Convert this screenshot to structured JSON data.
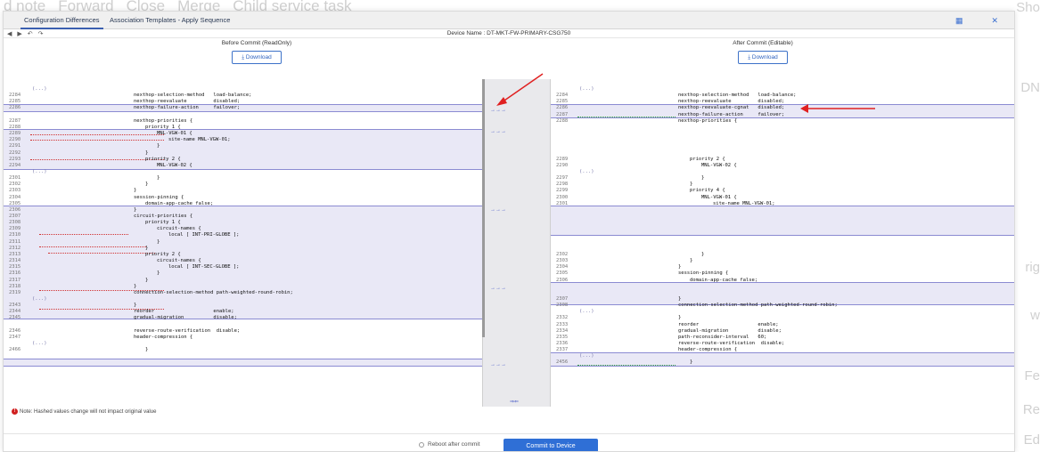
{
  "background": {
    "toolbar": [
      "d note",
      "Forward",
      "Close",
      "Merge",
      "Child service task"
    ],
    "right_fragments": [
      "Sho",
      "DN",
      "rig",
      "w",
      "Fe",
      "Re",
      "Ed"
    ]
  },
  "dialog": {
    "tabs": [
      "Configuration Differences",
      "Association Templates - Apply Sequence"
    ],
    "device_name": "Device Name : DT-MKT-FW-PRIMARY-CSG750",
    "left_title": "Before Commit (ReadOnly)",
    "right_title": "After Commit (Editable)",
    "download_label": "Download",
    "note": "Note: Hashed values change will not impact original value",
    "reboot_label": "Reboot after commit",
    "commit_label": "Commit to Device"
  },
  "left_lines": [
    {
      "ln": "",
      "text": "(...)",
      "indent": 0,
      "fold": true
    },
    {
      "ln": "2284",
      "text": "nexthop-selection-method   load-balance;",
      "indent": 2
    },
    {
      "ln": "2285",
      "text": "nexthop-reevaluate         disabled;",
      "indent": 2
    },
    {
      "ln": "2286",
      "text": "nexthop-failure-action     failover;",
      "indent": 2
    },
    {
      "ln": "",
      "text": "",
      "indent": 0
    },
    {
      "ln": "2287",
      "text": "nexthop-priorities {",
      "indent": 2
    },
    {
      "ln": "2288",
      "text": "priority 1 {",
      "indent": 3
    },
    {
      "ln": "2289",
      "text": "MNL-VGW-01 {",
      "indent": 4
    },
    {
      "ln": "2290",
      "text": "site-name MNL-VGW-01;",
      "indent": 5
    },
    {
      "ln": "2291",
      "text": "}",
      "indent": 4
    },
    {
      "ln": "2292",
      "text": "}",
      "indent": 3
    },
    {
      "ln": "2293",
      "text": "priority 2 {",
      "indent": 3
    },
    {
      "ln": "2294",
      "text": "MNL-VGW-02 {",
      "indent": 4
    },
    {
      "ln": "",
      "text": "(...)",
      "indent": 0,
      "fold": true
    },
    {
      "ln": "2301",
      "text": "}",
      "indent": 4
    },
    {
      "ln": "2302",
      "text": "}",
      "indent": 3
    },
    {
      "ln": "2303",
      "text": "}",
      "indent": 2
    },
    {
      "ln": "2304",
      "text": "session-pinning {",
      "indent": 2
    },
    {
      "ln": "2305",
      "text": "domain-app-cache false;",
      "indent": 3
    },
    {
      "ln": "2306",
      "text": "}",
      "indent": 2
    },
    {
      "ln": "2307",
      "text": "circuit-priorities {",
      "indent": 2
    },
    {
      "ln": "2308",
      "text": "priority 1 {",
      "indent": 3
    },
    {
      "ln": "2309",
      "text": "circuit-names {",
      "indent": 4
    },
    {
      "ln": "2310",
      "text": "local [ INT-PRI-GLOBE ];",
      "indent": 5
    },
    {
      "ln": "2311",
      "text": "}",
      "indent": 4
    },
    {
      "ln": "2312",
      "text": "}",
      "indent": 3
    },
    {
      "ln": "2313",
      "text": "priority 2 {",
      "indent": 3
    },
    {
      "ln": "2314",
      "text": "circuit-names {",
      "indent": 4
    },
    {
      "ln": "2315",
      "text": "local [ INT-SEC-GLOBE ];",
      "indent": 5
    },
    {
      "ln": "2316",
      "text": "}",
      "indent": 4
    },
    {
      "ln": "2317",
      "text": "}",
      "indent": 3
    },
    {
      "ln": "2318",
      "text": "}",
      "indent": 2
    },
    {
      "ln": "2319",
      "text": "connection-selection-method path-weighted-round-robin;",
      "indent": 2
    },
    {
      "ln": "",
      "text": "(...)",
      "indent": 0,
      "fold": true
    },
    {
      "ln": "2343",
      "text": "}",
      "indent": 2
    },
    {
      "ln": "2344",
      "text": "reorder                    enable;",
      "indent": 2
    },
    {
      "ln": "2345",
      "text": "gradual-migration          disable;",
      "indent": 2
    },
    {
      "ln": "",
      "text": "",
      "indent": 0
    },
    {
      "ln": "2346",
      "text": "reverse-route-verification  disable;",
      "indent": 2
    },
    {
      "ln": "2347",
      "text": "header-compression {",
      "indent": 2
    },
    {
      "ln": "",
      "text": "(...)",
      "indent": 0,
      "fold": true
    },
    {
      "ln": "2466",
      "text": "}",
      "indent": 3
    }
  ],
  "right_lines": [
    {
      "ln": "",
      "text": "(...)",
      "indent": 0,
      "fold": true
    },
    {
      "ln": "2284",
      "text": "nexthop-selection-method   load-balance;",
      "indent": 2
    },
    {
      "ln": "2285",
      "text": "nexthop-reevaluate         disabled;",
      "indent": 2
    },
    {
      "ln": "2286",
      "text": "nexthop-reevaluate-cgnat   disabled;",
      "indent": 2
    },
    {
      "ln": "2287",
      "text": "nexthop-failure-action     failover;",
      "indent": 2
    },
    {
      "ln": "2288",
      "text": "nexthop-priorities {",
      "indent": 2
    },
    {
      "ln": "",
      "text": "",
      "indent": 0
    },
    {
      "ln": "",
      "text": "",
      "indent": 0
    },
    {
      "ln": "",
      "text": "",
      "indent": 0
    },
    {
      "ln": "",
      "text": "",
      "indent": 0
    },
    {
      "ln": "",
      "text": "",
      "indent": 0
    },
    {
      "ln": "2289",
      "text": "priority 2 {",
      "indent": 3
    },
    {
      "ln": "2290",
      "text": "MNL-VGW-02 {",
      "indent": 4
    },
    {
      "ln": "",
      "text": "(...)",
      "indent": 0,
      "fold": true
    },
    {
      "ln": "2297",
      "text": "}",
      "indent": 4
    },
    {
      "ln": "2298",
      "text": "}",
      "indent": 3
    },
    {
      "ln": "2299",
      "text": "priority 4 {",
      "indent": 3
    },
    {
      "ln": "2300",
      "text": "MNL-VGW-01 {",
      "indent": 4
    },
    {
      "ln": "2301",
      "text": "site-name MNL-VGW-01;",
      "indent": 5
    },
    {
      "ln": "",
      "text": "",
      "indent": 0
    },
    {
      "ln": "",
      "text": "",
      "indent": 0
    },
    {
      "ln": "",
      "text": "",
      "indent": 0
    },
    {
      "ln": "",
      "text": "",
      "indent": 0
    },
    {
      "ln": "",
      "text": "",
      "indent": 0
    },
    {
      "ln": "",
      "text": "",
      "indent": 0
    },
    {
      "ln": "",
      "text": "",
      "indent": 0
    },
    {
      "ln": "2302",
      "text": "}",
      "indent": 4
    },
    {
      "ln": "2303",
      "text": "}",
      "indent": 3
    },
    {
      "ln": "2304",
      "text": "}",
      "indent": 2
    },
    {
      "ln": "2305",
      "text": "session-pinning {",
      "indent": 2
    },
    {
      "ln": "2306",
      "text": "domain-app-cache false;",
      "indent": 3
    },
    {
      "ln": "",
      "text": "",
      "indent": 0
    },
    {
      "ln": "",
      "text": "",
      "indent": 0
    },
    {
      "ln": "2307",
      "text": "}",
      "indent": 2
    },
    {
      "ln": "2308",
      "text": "connection-selection-method path-weighted-round-robin;",
      "indent": 2
    },
    {
      "ln": "",
      "text": "(...)",
      "indent": 0,
      "fold": true
    },
    {
      "ln": "2332",
      "text": "}",
      "indent": 2
    },
    {
      "ln": "2333",
      "text": "reorder                    enable;",
      "indent": 2
    },
    {
      "ln": "2334",
      "text": "gradual-migration          disable;",
      "indent": 2
    },
    {
      "ln": "2335",
      "text": "path-reconsider-interval   60;",
      "indent": 2
    },
    {
      "ln": "2336",
      "text": "reverse-route-verification  disable;",
      "indent": 2
    },
    {
      "ln": "2337",
      "text": "header-compression {",
      "indent": 2
    },
    {
      "ln": "",
      "text": "(...)",
      "indent": 0,
      "fold": true
    },
    {
      "ln": "2456",
      "text": "}",
      "indent": 3
    }
  ],
  "gutter_arrows": [
    "→→→",
    "→→→",
    "→→→",
    "→→→",
    "→→→",
    "→→→"
  ],
  "gutter_double_arrow": "⇒⇐",
  "colors": {
    "accent": "#2f6fd6",
    "annotation_red": "#e02020",
    "diff_border": "#8b8bd2",
    "diff_fill": "#e9e8f6"
  }
}
